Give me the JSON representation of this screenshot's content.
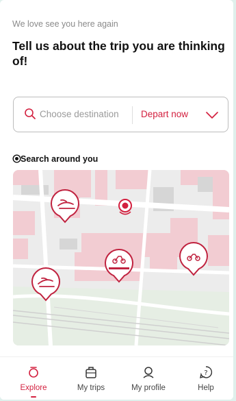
{
  "header": {
    "greeting": "We love see you here again",
    "title": "Tell us about the trip you are thinking of!"
  },
  "search": {
    "placeholder": "Choose destination",
    "depart_label": "Depart now"
  },
  "nearby": {
    "heading": "Search around you"
  },
  "map": {
    "markers": [
      "train-icon",
      "train-icon",
      "scooter-icon",
      "bike-icon",
      "location-dot-icon"
    ]
  },
  "nav": {
    "items": [
      {
        "label": "Explore",
        "icon": "compass-icon",
        "active": true
      },
      {
        "label": "My trips",
        "icon": "suitcase-icon",
        "active": false
      },
      {
        "label": "My profile",
        "icon": "profile-icon",
        "active": false
      },
      {
        "label": "Help",
        "icon": "help-icon",
        "active": false
      }
    ]
  },
  "colors": {
    "accent": "#d3203f",
    "map_building": "#f2ccd2",
    "map_bg": "#ececec",
    "page_bg": "#dff0ec"
  }
}
